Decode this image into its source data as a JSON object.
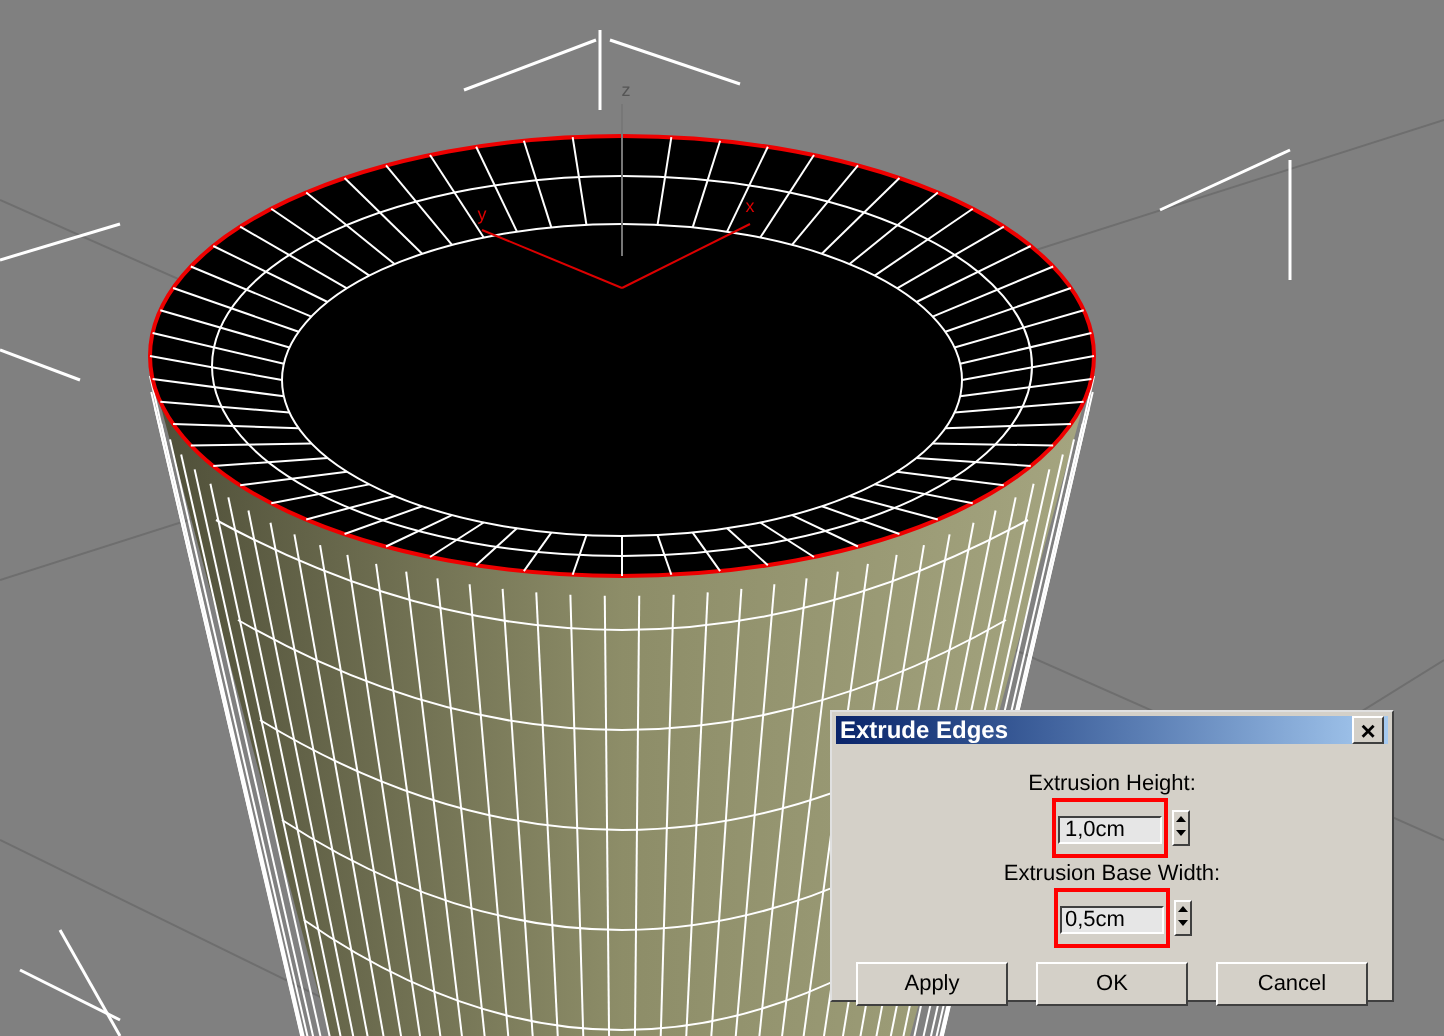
{
  "viewport": {
    "gizmo_axes": [
      {
        "kind": "z",
        "label": "z"
      },
      {
        "kind": "y",
        "label": "y"
      },
      {
        "kind": "x",
        "label": "x"
      }
    ]
  },
  "dialog": {
    "title": "Extrude Edges",
    "close": "×",
    "fields": [
      {
        "label": "Extrusion Height:",
        "value": "1,0cm"
      },
      {
        "label": "Extrusion Base Width:",
        "value": "0,5cm"
      }
    ],
    "buttons": [
      "Apply",
      "OK",
      "Cancel"
    ]
  }
}
